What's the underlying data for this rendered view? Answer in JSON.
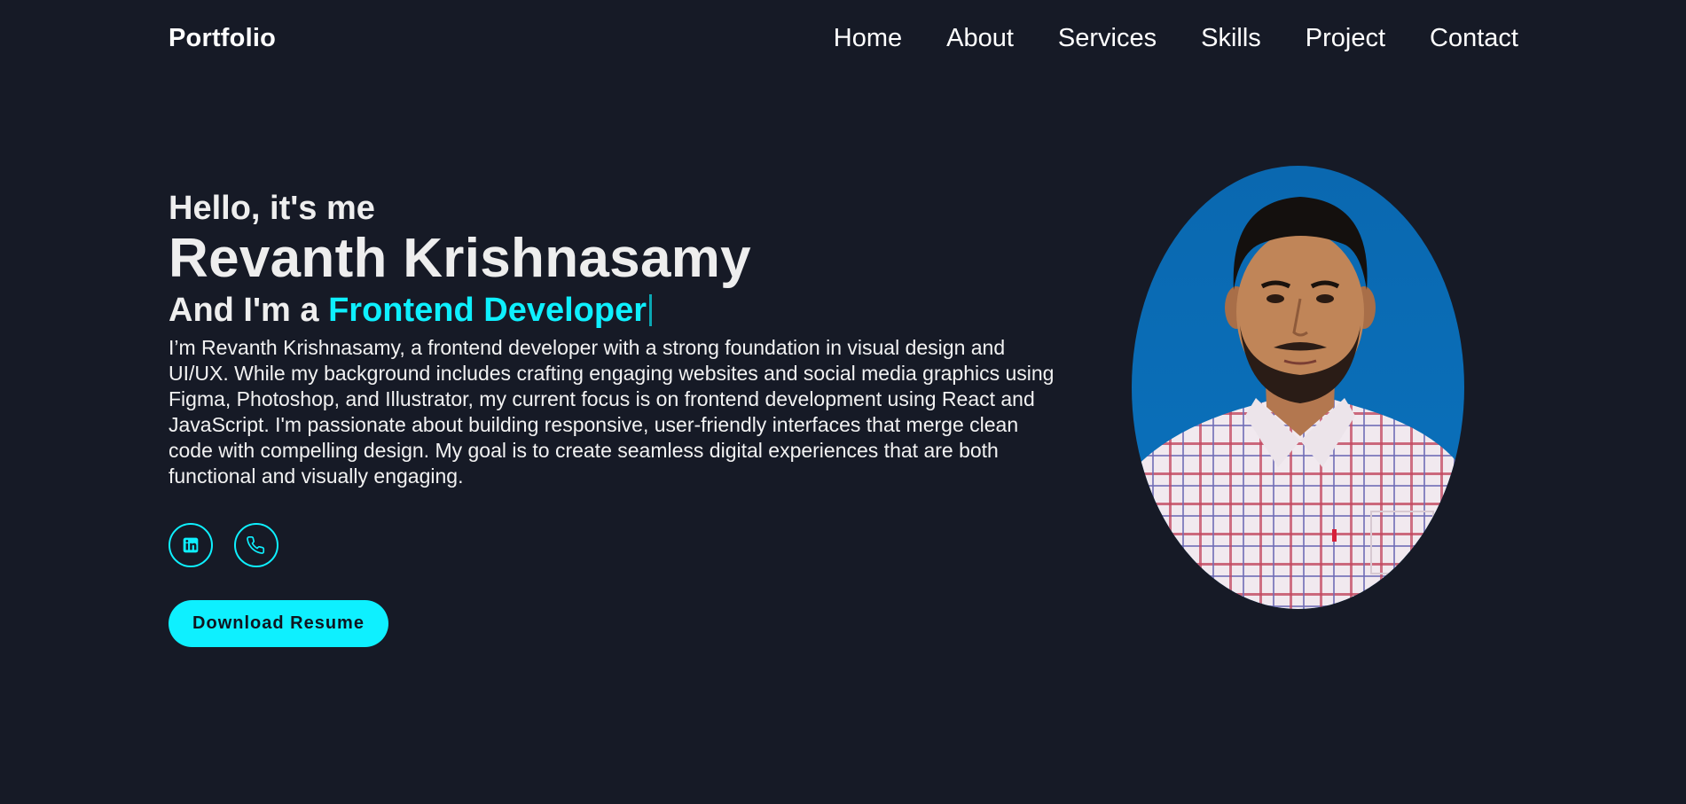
{
  "header": {
    "logo": "Portfolio",
    "nav": [
      {
        "label": "Home"
      },
      {
        "label": "About"
      },
      {
        "label": "Services"
      },
      {
        "label": "Skills"
      },
      {
        "label": "Project"
      },
      {
        "label": "Contact"
      }
    ]
  },
  "hero": {
    "greeting": "Hello, it's me",
    "name": "Revanth Krishnasamy",
    "role_prefix": "And I'm a ",
    "role": "Frontend Developer",
    "bio": "I’m Revanth Krishnasamy, a frontend developer with a strong foundation in visual design and UI/UX. While my background includes crafting engaging websites and social media graphics using Figma, Photoshop, and Illustrator, my current focus is on frontend development using React and JavaScript. I'm passionate about building responsive, user-friendly interfaces that merge clean code with compelling design. My goal is to create seamless digital experiences that are both functional and visually engaging.",
    "socials": [
      {
        "icon": "linkedin-icon"
      },
      {
        "icon": "phone-icon"
      }
    ],
    "resume_button": "Download Resume"
  },
  "colors": {
    "background": "#161a26",
    "accent": "#0ef0ff",
    "text": "#ffffff",
    "photo_background": "#0a6db5"
  }
}
